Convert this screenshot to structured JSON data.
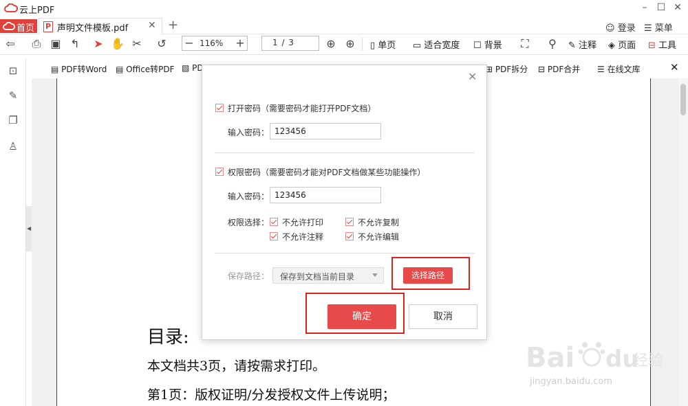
{
  "app": {
    "title": "云上PDF"
  },
  "tabs": {
    "home": "首页",
    "doc": "声明文件模板.pdf"
  },
  "header": {
    "login": "登录",
    "menu": "菜单"
  },
  "toolbar": {
    "zoom": "116%",
    "page": "1    / 3",
    "single_page": "单页",
    "fit_width": "适合宽度",
    "background": "背景",
    "annotate": "注释",
    "page_label": "页面",
    "tools": "工具"
  },
  "subbar": {
    "pdf_to_word": "PDF转Word",
    "office_to_pdf": "Office转PDF",
    "pdf_partial": "PD",
    "pdf_split": "PDF拆分",
    "pdf_merge": "PDF合并",
    "online_library": "在线文库"
  },
  "dialog": {
    "open_pw_label": "打开密码（需要密码才能打开PDF文档）",
    "input_label": "输入密码：",
    "open_pw_value": "123456",
    "perm_pw_label": "权限密码（需要密码才能对PDF文档做某些功能操作）",
    "perm_pw_value": "123456",
    "perm_select_label": "权限选择：",
    "perm_no_print": "不允许打印",
    "perm_no_copy": "不允许复制",
    "perm_no_annotate": "不允许注释",
    "perm_no_edit": "不允许编辑",
    "save_path_label": "保存路径：",
    "save_path_value": "保存到文档当前目录",
    "choose_path": "选择路径",
    "ok": "确定",
    "cancel": "取消"
  },
  "document": {
    "heading": "目录:",
    "line1": "本文档共3页，请按需求打印。",
    "line2": "第1页：版权证明/分发授权文件上传说明；"
  },
  "watermark": {
    "text": "jingyan.baidu.com"
  },
  "colors": {
    "accent": "#e84a4a",
    "highlight": "#e0201a"
  }
}
